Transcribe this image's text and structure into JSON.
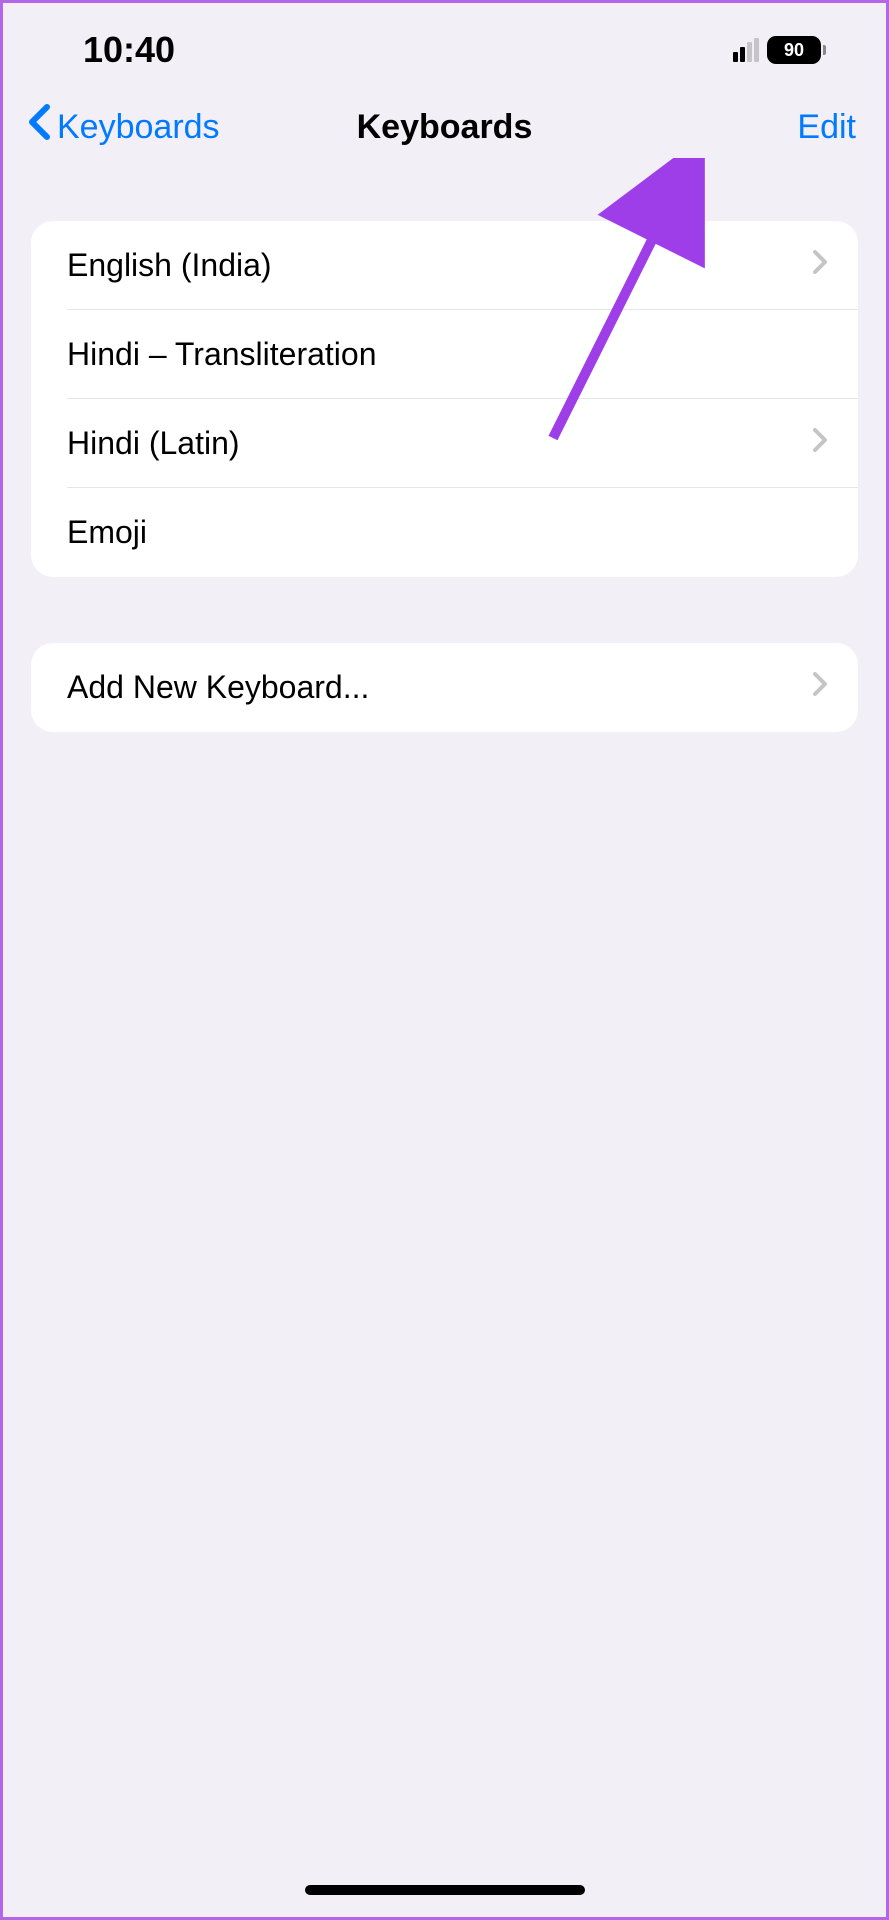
{
  "statusBar": {
    "time": "10:40",
    "batteryLevel": "90"
  },
  "navBar": {
    "backLabel": "Keyboards",
    "title": "Keyboards",
    "editLabel": "Edit"
  },
  "keyboards": {
    "items": [
      {
        "label": "English (India)",
        "hasChevron": true
      },
      {
        "label": "Hindi – Transliteration",
        "hasChevron": false
      },
      {
        "label": "Hindi (Latin)",
        "hasChevron": true
      },
      {
        "label": "Emoji",
        "hasChevron": false
      }
    ]
  },
  "addKeyboard": {
    "label": "Add New Keyboard..."
  }
}
